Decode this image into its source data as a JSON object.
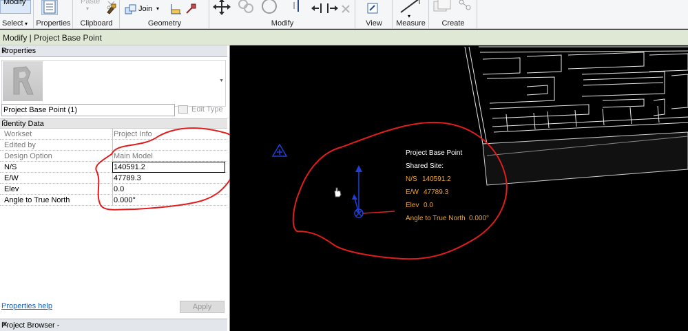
{
  "ribbon": {
    "panels": [
      {
        "name": "select",
        "label": "Select",
        "button": "Modify"
      },
      {
        "name": "properties",
        "label": "Properties"
      },
      {
        "name": "clipboard",
        "label": "Clipboard",
        "button": "Paste"
      },
      {
        "name": "geometry",
        "label": "Geometry",
        "button": "Join"
      },
      {
        "name": "modify",
        "label": "Modify"
      },
      {
        "name": "view",
        "label": "View"
      },
      {
        "name": "measure",
        "label": "Measure"
      },
      {
        "name": "create",
        "label": "Create"
      }
    ],
    "select_dropdown_icon": "chevron-down-icon"
  },
  "context": {
    "title": "Modify | Project Base Point"
  },
  "properties": {
    "title": "Properties",
    "close_icon": "close-icon",
    "type_selector": "Project Base Point (1)",
    "edit_type": "Edit Type",
    "group": "Identity Data",
    "rows": [
      {
        "label": "Workset",
        "value": "Project Info"
      },
      {
        "label": "Edited by",
        "value": ""
      },
      {
        "label": "Design Option",
        "value": "Main Model"
      },
      {
        "label": "N/S",
        "value": "140591.2"
      },
      {
        "label": "E/W",
        "value": "47789.3"
      },
      {
        "label": "Elev",
        "value": "0.0"
      },
      {
        "label": "Angle to True North",
        "value": "0.000°"
      }
    ],
    "help": "Properties help",
    "apply": "Apply"
  },
  "project_browser": {
    "title": "Project Browser -"
  },
  "tooltip": {
    "title": "Project Base Point",
    "shared_site": "Shared Site:",
    "ns_label": "N/S",
    "ns_value": "140591.2",
    "ew_label": "E/W",
    "ew_value": "47789.3",
    "elev_label": "Elev",
    "elev_value": "0.0",
    "angle_label": "Angle to True North",
    "angle_value": "0.000°"
  },
  "colors": {
    "annotation_red": "#e11d1d",
    "tooltip_orange": "#f0a637",
    "base_point_blue": "#1f3fd6",
    "ribbon_bg": "#f5f6f7",
    "context_bar": "#dfe8d4"
  }
}
